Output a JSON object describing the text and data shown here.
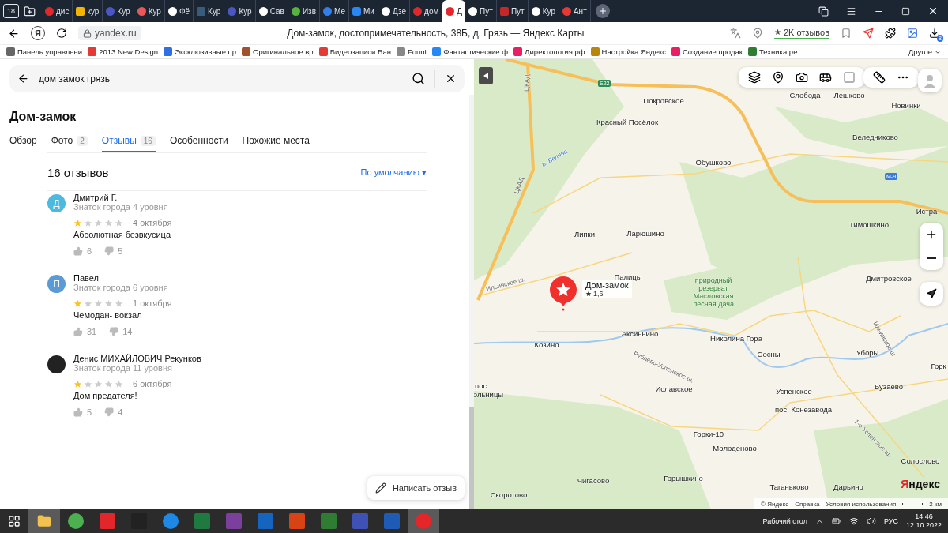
{
  "browser": {
    "tab_counter": "18",
    "tabs": [
      {
        "label": "дис",
        "selected": false
      },
      {
        "label": "кур",
        "selected": false
      },
      {
        "label": "Кур",
        "selected": false
      },
      {
        "label": "Кур",
        "selected": false
      },
      {
        "label": "Фё",
        "selected": false
      },
      {
        "label": "Кур",
        "selected": false
      },
      {
        "label": "Кур",
        "selected": false
      },
      {
        "label": "Сав",
        "selected": false
      },
      {
        "label": "Изв",
        "selected": false
      },
      {
        "label": "Ме",
        "selected": false
      },
      {
        "label": "Ми",
        "selected": false
      },
      {
        "label": "Дзе",
        "selected": false
      },
      {
        "label": "дом",
        "selected": false
      },
      {
        "label": "Д",
        "selected": true
      },
      {
        "label": "Пут",
        "selected": false
      },
      {
        "label": "Пут",
        "selected": false
      },
      {
        "label": "Кур",
        "selected": false
      },
      {
        "label": "Ант",
        "selected": false
      }
    ],
    "logo": "Я",
    "url": "yandex.ru",
    "page_title": "Дом-замок, достопримечательность, 38Б, д. Грязь — Яндекс Карты",
    "reviews_badge": "2K отзывов",
    "downloads_count": "8",
    "bookmarks": [
      "Панель управлени",
      "2013 New Design",
      "Эксклюзивные пр",
      "Оригинальное вр",
      "Видеозаписи Ван",
      "Fount",
      "Фантастические ф",
      "Директология.рф",
      "Настройка Яндекс",
      "Создание продак",
      "Техника ре"
    ],
    "other_bookmarks": "Другое"
  },
  "search": {
    "value": "дом замок грязь"
  },
  "place": {
    "title": "Дом-замок",
    "tabs": [
      {
        "label": "Обзор",
        "selected": false
      },
      {
        "label": "Фото",
        "count": "2",
        "selected": false
      },
      {
        "label": "Отзывы",
        "count": "16",
        "selected": true
      },
      {
        "label": "Особенности",
        "selected": false
      },
      {
        "label": "Похожие места",
        "selected": false
      }
    ]
  },
  "reviews": {
    "heading": "16 отзывов",
    "sort": "По умолчанию ▾",
    "write_button": "Написать отзыв",
    "items": [
      {
        "author": "Дмитрий Г.",
        "avatar": {
          "kind": "letter",
          "initial": "Д",
          "color": "#4cb9de"
        },
        "level": "Знаток города 4 уровня",
        "stars": 1,
        "date": "4 октября",
        "text": "Абсолютная безвкусица",
        "likes": "6",
        "dislikes": "5"
      },
      {
        "author": "Павел",
        "avatar": {
          "kind": "letter",
          "initial": "П",
          "color": "#5b9bd5"
        },
        "level": "Знаток города 6 уровня",
        "stars": 1,
        "date": "1 октября",
        "text": "Чемодан- вокзал",
        "likes": "31",
        "dislikes": "14"
      },
      {
        "author": "Денис МИХАЙЛОВИЧ Рекунков",
        "avatar": {
          "kind": "photo"
        },
        "level": "Знаток города 11 уровня",
        "stars": 1,
        "date": "6 октября",
        "text": "Дом предателя!",
        "likes": "5",
        "dislikes": "4"
      }
    ]
  },
  "map": {
    "marker": {
      "title": "Дом-замок",
      "rating": "1,6"
    },
    "road_badges": [
      {
        "label": "E22",
        "color": "#2e8b57"
      },
      {
        "label": "M-9",
        "color": "#3d7bd9"
      }
    ],
    "labels": [
      {
        "label": "Покровское",
        "kind": "town"
      },
      {
        "label": "Красный Посёлок",
        "kind": "town"
      },
      {
        "label": "Слобода",
        "kind": "town"
      },
      {
        "label": "Лешково",
        "kind": "town"
      },
      {
        "label": "Новинки",
        "kind": "town"
      },
      {
        "label": "Веледниково",
        "kind": "town"
      },
      {
        "label": "Обушково",
        "kind": "town"
      },
      {
        "label": "Истра",
        "kind": "town"
      },
      {
        "label": "Тимошкино",
        "kind": "town"
      },
      {
        "label": "Липки",
        "kind": "town"
      },
      {
        "label": "Ларюшино",
        "kind": "town"
      },
      {
        "label": "Палицы",
        "kind": "town"
      },
      {
        "label": "природный резерват Масловская лесная дача",
        "kind": "reserve"
      },
      {
        "label": "Дмитровское",
        "kind": "town"
      },
      {
        "label": "Аксиньино",
        "kind": "town"
      },
      {
        "label": "Николина Гора",
        "kind": "town"
      },
      {
        "label": "Козино",
        "kind": "town"
      },
      {
        "label": "Сосны",
        "kind": "town"
      },
      {
        "label": "Уборы",
        "kind": "town"
      },
      {
        "label": "Горк",
        "kind": "town"
      },
      {
        "label": "пос.",
        "kind": "town"
      },
      {
        "label": "ольницы",
        "kind": "town"
      },
      {
        "label": "Бузаево",
        "kind": "town"
      },
      {
        "label": "Успенское",
        "kind": "town"
      },
      {
        "label": "Иславское",
        "kind": "town"
      },
      {
        "label": "пос. Конезавода",
        "kind": "town"
      },
      {
        "label": "Горки-10",
        "kind": "town"
      },
      {
        "label": "Молоденово",
        "kind": "town"
      },
      {
        "label": "Солослово",
        "kind": "town"
      },
      {
        "label": "Чигасово",
        "kind": "town"
      },
      {
        "label": "Горышкино",
        "kind": "town"
      },
      {
        "label": "Таганьково",
        "kind": "town"
      },
      {
        "label": "Дарьино",
        "kind": "town"
      },
      {
        "label": "Скоротово",
        "kind": "town"
      },
      {
        "label": "ЦКАД",
        "kind": "road"
      },
      {
        "label": "ЦКАД",
        "kind": "road"
      },
      {
        "label": "р. Беляна",
        "kind": "river"
      },
      {
        "label": "Ильинское ш.",
        "kind": "road"
      },
      {
        "label": "Ильинское ш.",
        "kind": "road"
      },
      {
        "label": "Рублёво-Успенское ш.",
        "kind": "road"
      },
      {
        "label": "1-е Успенское ш.",
        "kind": "road"
      }
    ],
    "logo": "Яндекс",
    "footer": [
      "© Яндекс",
      "Справка",
      "Условия использования"
    ],
    "scale": "2 км"
  },
  "taskbar": {
    "desktop": "Рабочий стол",
    "language": "РУС",
    "time": "14:46",
    "date": "12.10.2022"
  }
}
